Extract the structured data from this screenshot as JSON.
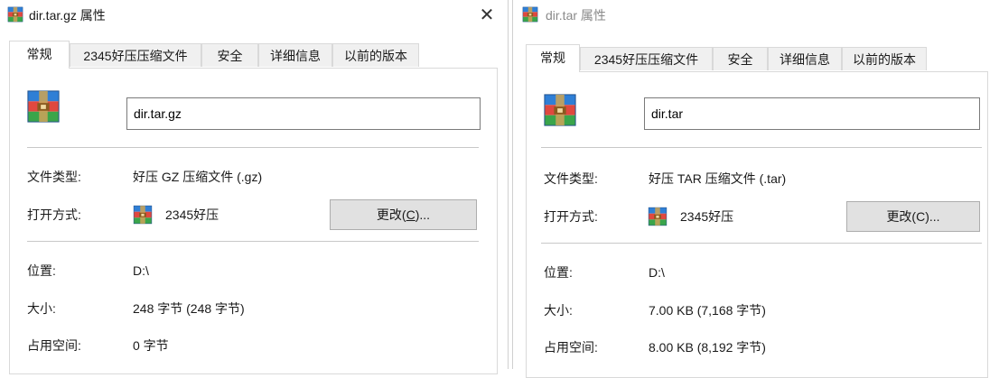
{
  "windows": [
    {
      "title": "dir.tar.gz 属性",
      "close_glyph": "✕",
      "tabs": [
        "常规",
        "2345好压压缩文件",
        "安全",
        "详细信息",
        "以前的版本"
      ],
      "active_tab": "常规",
      "filename": "dir.tar.gz",
      "labels": {
        "type": "文件类型:",
        "open_with": "打开方式:",
        "location": "位置:",
        "size": "大小:",
        "size_on_disk": "占用空间:"
      },
      "values": {
        "type": "好压 GZ 压缩文件 (.gz)",
        "open_with_app": "2345好压",
        "location": "D:\\",
        "size": "248 字节 (248 字节)",
        "size_on_disk": "0 字节"
      },
      "change_button": {
        "prefix": "更改(",
        "accel": "C",
        "suffix": ")..."
      },
      "icon": "winrar-archive-icon"
    },
    {
      "title": "dir.tar 属性",
      "tabs": [
        "常规",
        "2345好压压缩文件",
        "安全",
        "详细信息",
        "以前的版本"
      ],
      "active_tab": "常规",
      "filename": "dir.tar",
      "labels": {
        "type": "文件类型:",
        "open_with": "打开方式:",
        "location": "位置:",
        "size": "大小:",
        "size_on_disk": "占用空间:"
      },
      "values": {
        "type": "好压 TAR 压缩文件 (.tar)",
        "open_with_app": "2345好压",
        "location": "D:\\",
        "size": "7.00 KB (7,168 字节)",
        "size_on_disk": "8.00 KB (8,192 字节)"
      },
      "change_button": {
        "label": "更改(C)..."
      },
      "icon": "winrar-archive-icon"
    }
  ]
}
